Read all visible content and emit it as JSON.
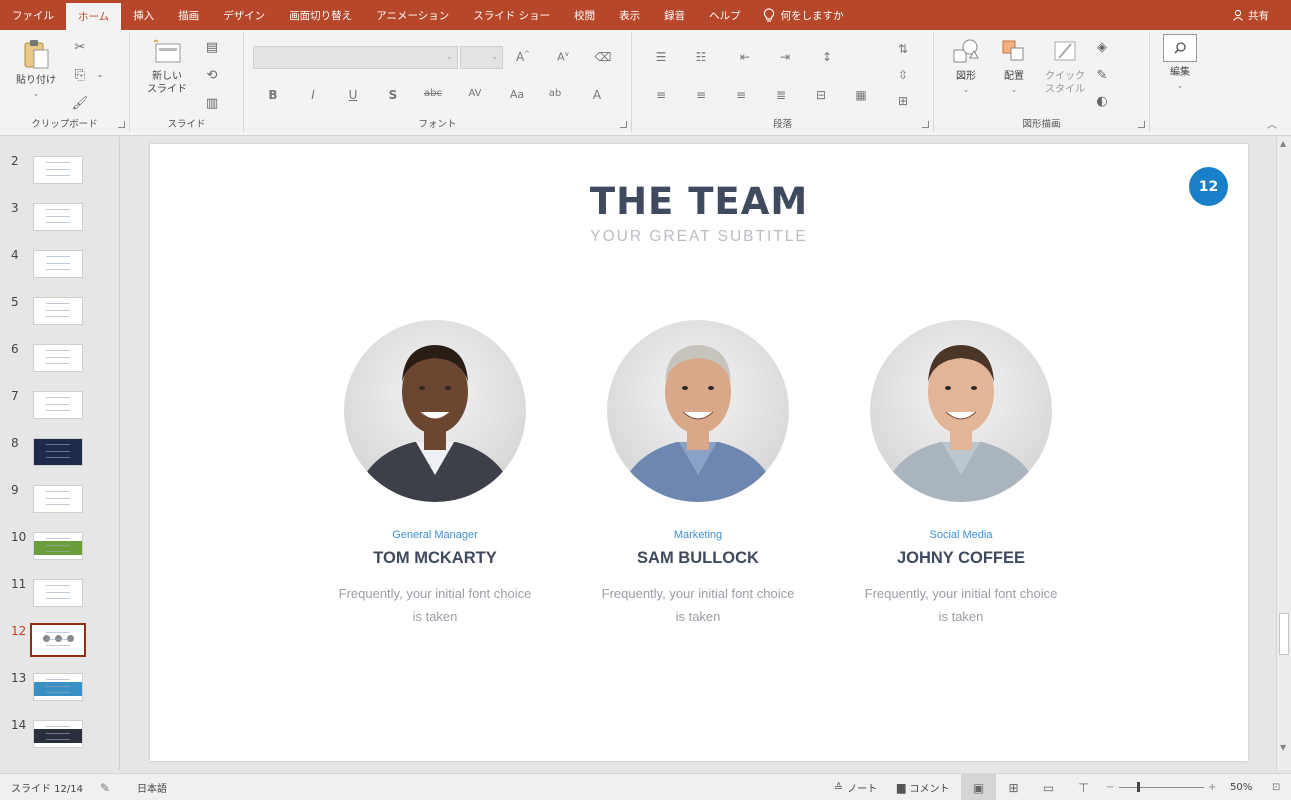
{
  "menu": {
    "tabs": [
      "ファイル",
      "ホーム",
      "挿入",
      "描画",
      "デザイン",
      "画面切り替え",
      "アニメーション",
      "スライド ショー",
      "校閲",
      "表示",
      "録音",
      "ヘルプ"
    ],
    "active_tab": "ホーム",
    "tell_me": "何をしますか",
    "share": "共有"
  },
  "ribbon": {
    "clipboard": {
      "label": "クリップボード",
      "paste": "貼り付け"
    },
    "slides": {
      "label": "スライド",
      "new_slide_line1": "新しい",
      "new_slide_line2": "スライド"
    },
    "font": {
      "label": "フォント"
    },
    "paragraph": {
      "label": "段落"
    },
    "drawing": {
      "label": "図形描画",
      "shapes": "図形",
      "arrange": "配置",
      "quick_line1": "クイック",
      "quick_line2": "スタイル"
    },
    "editing": {
      "label": "編集"
    }
  },
  "thumbnails": [
    {
      "num": "2"
    },
    {
      "num": "3"
    },
    {
      "num": "4"
    },
    {
      "num": "5"
    },
    {
      "num": "6"
    },
    {
      "num": "7"
    },
    {
      "num": "8"
    },
    {
      "num": "9"
    },
    {
      "num": "10"
    },
    {
      "num": "11"
    },
    {
      "num": "12"
    },
    {
      "num": "13"
    },
    {
      "num": "14"
    }
  ],
  "selected_slide": "12",
  "slide": {
    "title": "THE TEAM",
    "subtitle": "YOUR GREAT SUBTITLE",
    "number": "12",
    "members": [
      {
        "role": "General Manager",
        "name": "TOM MCKARTY",
        "desc_line1": "Frequently, your initial font choice",
        "desc_line2": "is taken",
        "skin": "#6b4630",
        "hair": "#2a1d16",
        "suit": "#3d4048",
        "shirt": "#eef0f3"
      },
      {
        "role": "Marketing",
        "name": "SAM BULLOCK",
        "desc_line1": "Frequently, your initial font choice",
        "desc_line2": "is taken",
        "skin": "#d9a888",
        "hair": "#c7c3bd",
        "suit": "#6d87b0",
        "shirt": "#8aa2c6"
      },
      {
        "role": "Social Media",
        "name": "JOHNY COFFEE",
        "desc_line1": "Frequently, your initial font choice",
        "desc_line2": "is taken",
        "skin": "#e2b597",
        "hair": "#4a3526",
        "suit": "#a9b4be",
        "shirt": "#bcc6cf"
      }
    ]
  },
  "status": {
    "slide_info": "スライド 12/14",
    "language": "日本語",
    "notes": "ノート",
    "comments": "コメント",
    "zoom": "50%"
  },
  "colors": {
    "accent": "#b7472a",
    "badge": "#1a7fc9",
    "title": "#3f4a5e",
    "role": "#3e8fd0"
  }
}
